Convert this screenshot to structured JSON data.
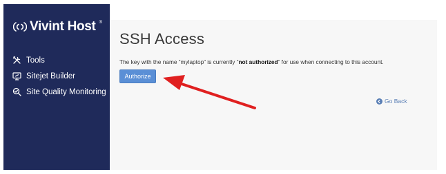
{
  "sidebar": {
    "logo_text": "Vivint Host",
    "logo_mark": "®",
    "items": [
      {
        "label": "Tools",
        "icon": "tools-icon"
      },
      {
        "label": "Sitejet Builder",
        "icon": "monitor-icon"
      },
      {
        "label": "Site Quality Monitoring",
        "icon": "search-icon"
      }
    ]
  },
  "page": {
    "title": "SSH Access",
    "desc_prefix": "The key with the name “mylaptop” is currently “",
    "desc_bold": "not authorized",
    "desc_suffix": "” for use when connecting to this account.",
    "authorize_label": "Authorize",
    "go_back_label": "Go Back"
  },
  "colors": {
    "sidebar_bg": "#1f2a5a",
    "button_bg": "#5a8fd6",
    "annotation_arrow": "#e02020"
  }
}
